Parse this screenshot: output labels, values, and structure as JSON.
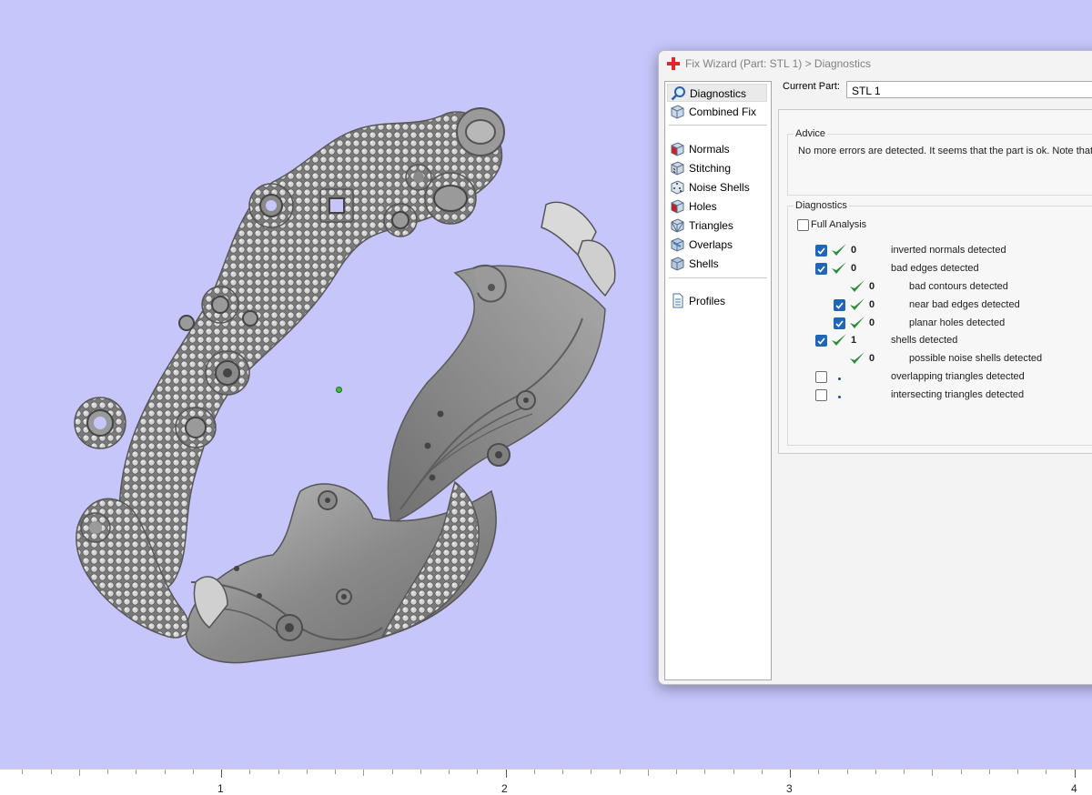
{
  "dialog": {
    "title": "Fix Wizard (Part: STL 1) > Diagnostics",
    "current_part_label": "Current Part:",
    "current_part_value": "STL 1"
  },
  "nav": {
    "items": [
      {
        "label": "Diagnostics",
        "icon": "magnifier-icon",
        "selected": true
      },
      {
        "label": "Combined Fix",
        "icon": "cube-icon"
      },
      {
        "label": "Normals",
        "icon": "cube-red-face-icon"
      },
      {
        "label": "Stitching",
        "icon": "cube-stitch-icon"
      },
      {
        "label": "Noise Shells",
        "icon": "cube-dots-icon"
      },
      {
        "label": "Holes",
        "icon": "cube-hole-icon"
      },
      {
        "label": "Triangles",
        "icon": "cube-triangles-icon"
      },
      {
        "label": "Overlaps",
        "icon": "cube-overlap-icon"
      },
      {
        "label": "Shells",
        "icon": "cube-shells-icon"
      },
      {
        "label": "Profiles",
        "icon": "document-icon"
      }
    ]
  },
  "advice": {
    "title": "Advice",
    "text": "No more errors are detected. It seems that the part is ok. Note that"
  },
  "diagnostics": {
    "title": "Diagnostics",
    "full_analysis_label": "Full Analysis",
    "full_analysis_checked": false,
    "rows": [
      {
        "checked": true,
        "status": "ok",
        "count": "0",
        "label": "inverted normals detected"
      },
      {
        "checked": true,
        "status": "ok",
        "count": "0",
        "label": "bad edges detected"
      },
      {
        "checked": null,
        "status": "ok",
        "count": "0",
        "label": "bad contours detected"
      },
      {
        "checked": true,
        "status": "ok",
        "count": "0",
        "label": "near bad edges detected"
      },
      {
        "checked": true,
        "status": "ok",
        "count": "0",
        "label": "planar holes detected"
      },
      {
        "checked": true,
        "status": "ok",
        "count": "1",
        "label": "shells detected"
      },
      {
        "checked": null,
        "status": "ok",
        "count": "0",
        "label": "possible noise shells detected"
      },
      {
        "checked": false,
        "status": "pending",
        "count": "",
        "label": "overlapping triangles detected"
      },
      {
        "checked": false,
        "status": "pending",
        "count": "",
        "label": "intersecting triangles detected"
      }
    ]
  },
  "ruler": {
    "labels": [
      "1",
      "2",
      "3",
      "4"
    ]
  },
  "colors": {
    "viewport_bg": "#c6c6fb",
    "model": "#8e8e8e",
    "check_green": "#2e8b3a",
    "checkbox_blue": "#1f66b8"
  }
}
